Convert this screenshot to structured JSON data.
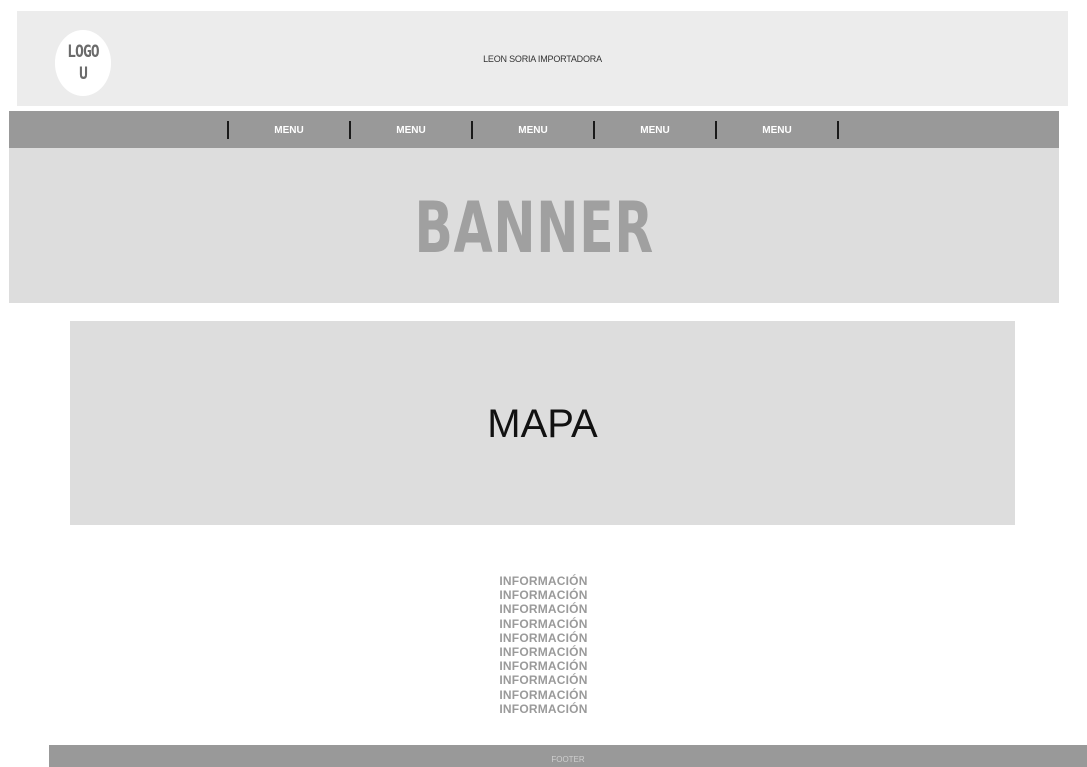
{
  "header": {
    "logo_line1": "LOGO",
    "logo_line2": "U",
    "title": "LEON SORIA IMPORTADORA"
  },
  "nav": {
    "items": [
      {
        "label": "MENU"
      },
      {
        "label": "MENU"
      },
      {
        "label": "MENU"
      },
      {
        "label": "MENU"
      },
      {
        "label": "MENU"
      }
    ]
  },
  "banner": {
    "text": "BANNER"
  },
  "map": {
    "text": "MAPA"
  },
  "info": {
    "lines": [
      "INFORMACIÓN",
      "INFORMACIÓN",
      "INFORMACIÓN",
      "INFORMACIÓN",
      "INFORMACIÓN",
      "INFORMACIÓN",
      "INFORMACIÓN",
      "INFORMACIÓN",
      "INFORMACIÓN",
      "INFORMACIÓN"
    ]
  },
  "footer": {
    "text": "FOOTER"
  },
  "colors": {
    "header_bg": "#ececec",
    "nav_bg": "#999999",
    "banner_bg": "#dddddd",
    "banner_text": "#a0a0a0",
    "info_text": "#9a9a9a"
  }
}
